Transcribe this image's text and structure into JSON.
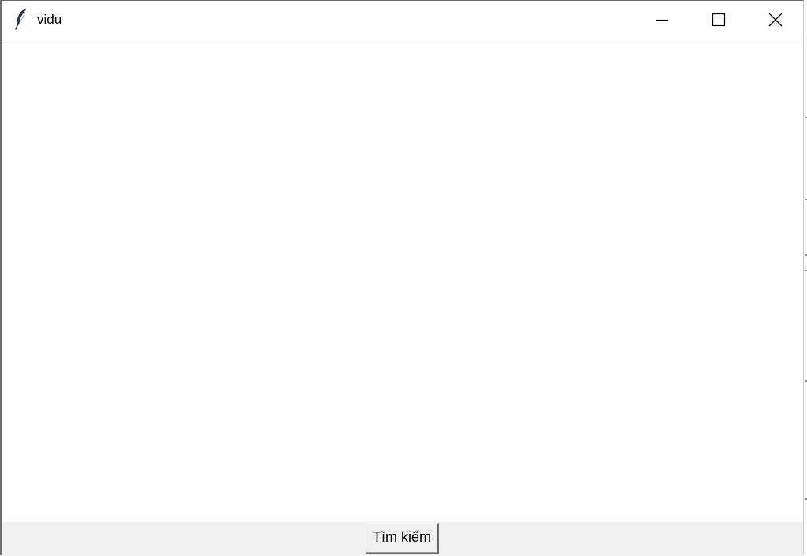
{
  "window": {
    "title": "vidu",
    "app_icon": "feather-icon",
    "controls": {
      "minimize_icon": "minimize-icon",
      "maximize_icon": "maximize-icon",
      "close_icon": "close-icon"
    }
  },
  "bottom_bar": {
    "search_button_label": "Tìm kiếm"
  },
  "colors": {
    "window_background": "#ffffff",
    "bottom_bar_background": "#f0f0f0",
    "title_text": "#000000"
  }
}
